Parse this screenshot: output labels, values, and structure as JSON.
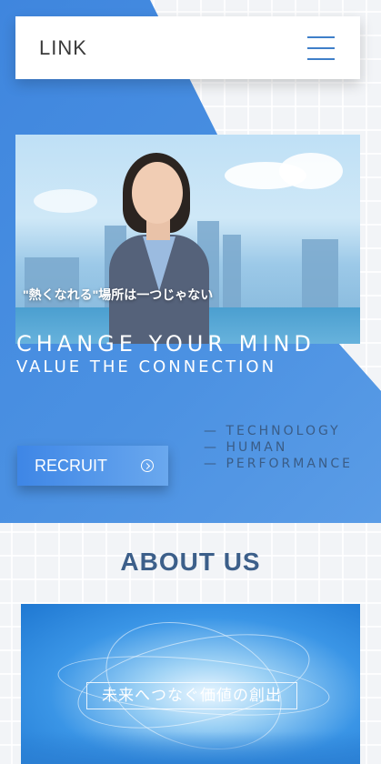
{
  "header": {
    "logo": "LINK",
    "menu_icon": "hamburger-menu-icon"
  },
  "hero": {
    "caption": "\"熱くなれる\"場所は一つじゃない",
    "tagline_main": "CHANGE YOUR MIND",
    "tagline_sub": "VALUE THE CONNECTION",
    "keywords": [
      "— TECHNOLOGY",
      "— HUMAN",
      "— PERFORMANCE"
    ],
    "cta": {
      "label": "RECRUIT",
      "icon": "arrow-circle-right-icon"
    }
  },
  "about": {
    "title": "ABOUT US",
    "caption": "未来へつなぐ価値の創出"
  },
  "colors": {
    "brand_blue": "#4a8fe0",
    "title_blue": "#3c5f8a",
    "keyword_text": "#3a5c86"
  }
}
